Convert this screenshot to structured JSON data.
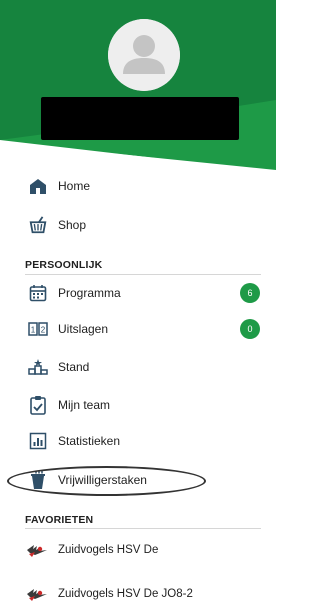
{
  "nav_main": [
    {
      "label": "Home",
      "icon": "home-icon"
    },
    {
      "label": "Shop",
      "icon": "basket-icon"
    }
  ],
  "sections": {
    "personal": "PERSOONLIJK",
    "favorites": "FAVORIETEN"
  },
  "nav_personal": [
    {
      "label": "Programma",
      "icon": "calendar-icon",
      "badge": "6"
    },
    {
      "label": "Uitslagen",
      "icon": "scoreboard-icon",
      "badge": "0"
    },
    {
      "label": "Stand",
      "icon": "podium-icon"
    },
    {
      "label": "Mijn team",
      "icon": "clipboard-check-icon"
    },
    {
      "label": "Statistieken",
      "icon": "bar-chart-icon"
    },
    {
      "label": "Vrijwilligerstaken",
      "icon": "drink-cup-icon"
    }
  ],
  "favorites": [
    {
      "label": "Zuidvogels HSV De",
      "icon": "club-logo-icon"
    },
    {
      "label": "Zuidvogels HSV De JO8-2",
      "icon": "club-logo-icon"
    }
  ],
  "colors": {
    "header_green": "#14803c",
    "header_light_green": "#1e9a47",
    "badge_green": "#1e9a47",
    "icon_blue": "#2f4f68"
  }
}
